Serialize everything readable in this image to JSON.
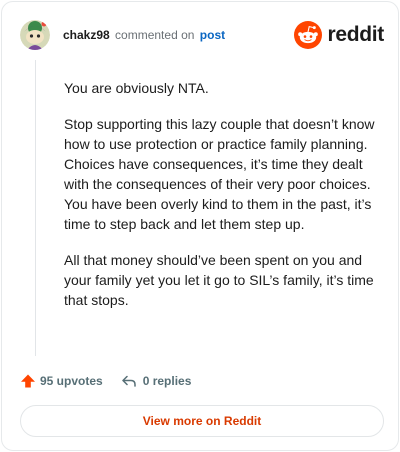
{
  "header": {
    "username": "chakz98",
    "action": "commented on",
    "post_link": "post",
    "brand": "reddit"
  },
  "comment": {
    "paragraphs": [
      "You are obviously NTA.",
      "Stop supporting this lazy couple that doesn’t know how to use protection or practice family planning. Choices have consequences, it’s time they dealt with the consequences of their very poor choices. You have been overly kind to them in the past, it’s time to step back and let them step up.",
      "All that money should’ve been spent on you and your family yet you let it go to SIL’s family, it’s time that stops."
    ]
  },
  "footer": {
    "upvotes": "95 upvotes",
    "replies": "0 replies",
    "view_more": "View more on Reddit"
  },
  "colors": {
    "brand_orange": "#ff4500",
    "link_blue": "#0a66c2",
    "cta_text": "#d93a00",
    "meta_gray": "#576f76"
  },
  "icons": {
    "avatar": "snoo-avatar-icon",
    "logo": "reddit-snoo-icon",
    "upvote": "upvote-arrow-icon",
    "reply": "reply-arrow-icon"
  }
}
